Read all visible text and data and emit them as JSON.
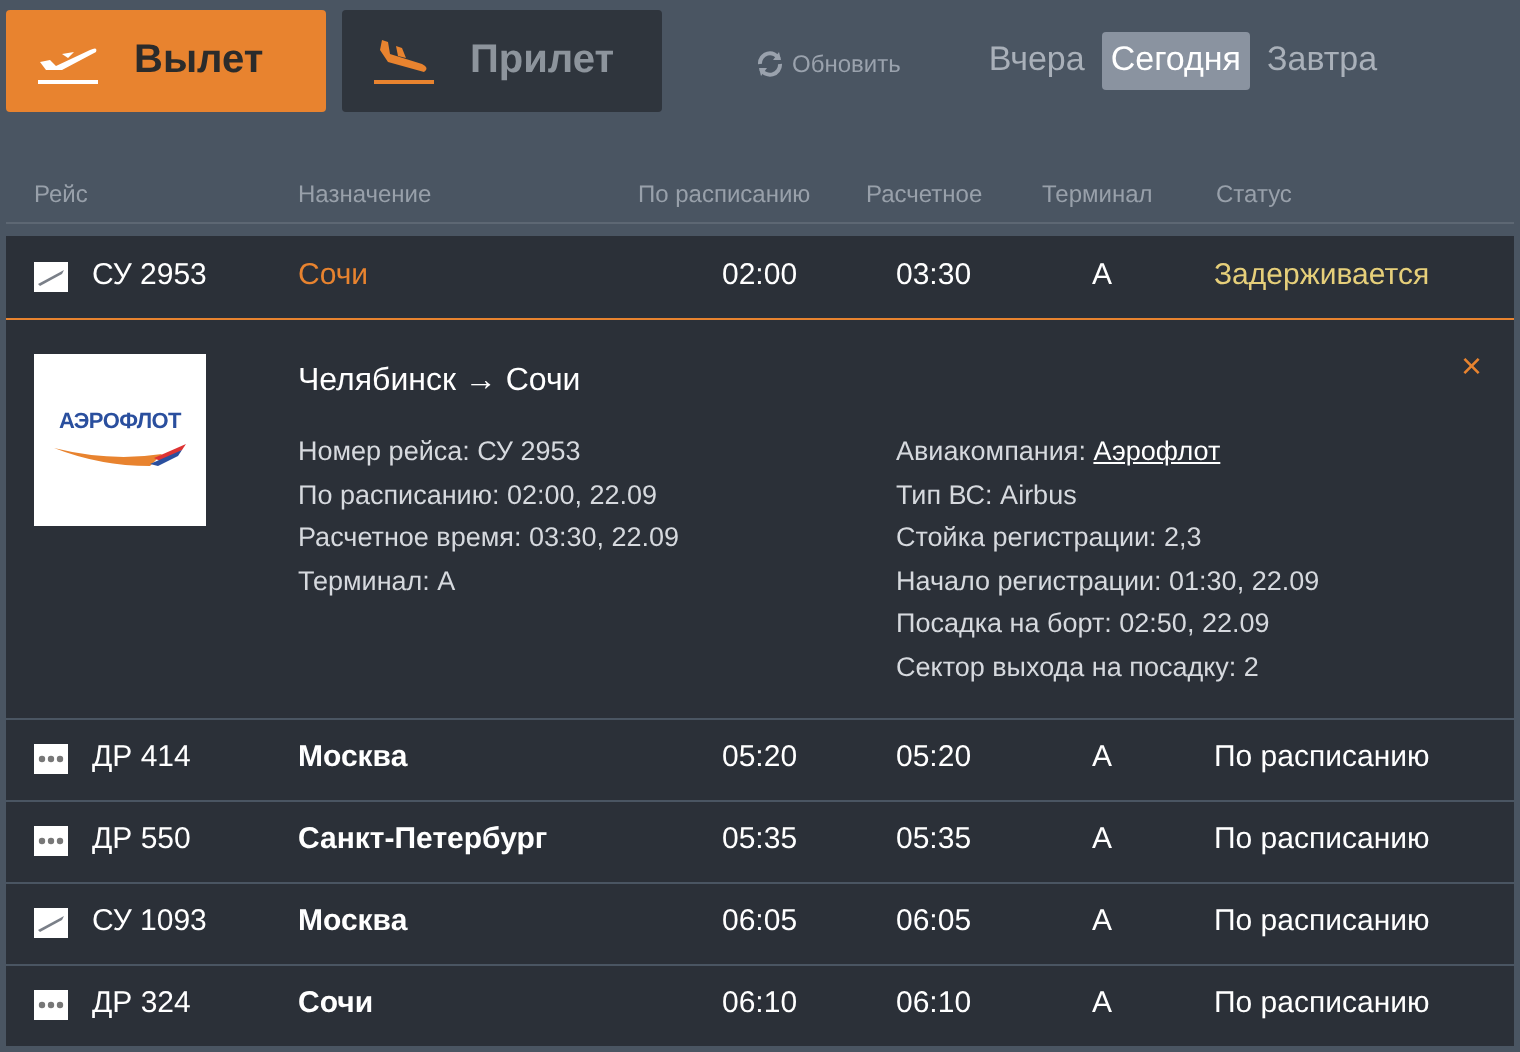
{
  "direction_tabs": [
    {
      "label": "Вылет",
      "kind": "departure",
      "selected": true
    },
    {
      "label": "Прилет",
      "kind": "arrival",
      "selected": false
    }
  ],
  "refresh": {
    "label": "Обновить"
  },
  "day_tabs": [
    {
      "label": "Вчера",
      "selected": false
    },
    {
      "label": "Сегодня",
      "selected": true
    },
    {
      "label": "Завтра",
      "selected": false
    }
  ],
  "table": {
    "columns": [
      "Рейс",
      "Назначение",
      "По расписанию",
      "Расчетное",
      "Терминал",
      "Статус"
    ],
    "rows": [
      {
        "kind": "plane",
        "flight": "СУ 2953",
        "destination": "Сочи",
        "scheduled": "02:00",
        "estimated": "03:30",
        "terminal": "A",
        "status": "Задерживается",
        "delayed": true,
        "expanded": true,
        "details": {
          "logo_text": "АЭРОФЛОТ",
          "route": "Челябинск → Сочи",
          "left": [
            "Номер рейса: СУ 2953",
            "По расписанию: 02:00, 22.09",
            "Расчетное время: 03:30, 22.09",
            "Терминал: A"
          ],
          "airline_label": "Авиакомпания: ",
          "airline_link": "Аэрофлот",
          "right": [
            "Тип ВС: Airbus",
            "Стойка регистрации: 2,3",
            "Начало регистрации: 01:30, 22.09",
            "Посадка на борт: 02:50, 22.09",
            "Сектор выхода на посадку: 2"
          ],
          "close": "×"
        }
      },
      {
        "kind": "dots",
        "flight": "ДР 414",
        "destination": "Москва",
        "scheduled": "05:20",
        "estimated": "05:20",
        "terminal": "A",
        "status": "По расписанию",
        "delayed": false,
        "expanded": false
      },
      {
        "kind": "dots",
        "flight": "ДР 550",
        "destination": "Санкт-Петербург",
        "scheduled": "05:35",
        "estimated": "05:35",
        "terminal": "A",
        "status": "По расписанию",
        "delayed": false,
        "expanded": false
      },
      {
        "kind": "plane",
        "flight": "СУ 1093",
        "destination": "Москва",
        "scheduled": "06:05",
        "estimated": "06:05",
        "terminal": "A",
        "status": "По расписанию",
        "delayed": false,
        "expanded": false
      },
      {
        "kind": "dots",
        "flight": "ДР 324",
        "destination": "Сочи",
        "scheduled": "06:10",
        "estimated": "06:10",
        "terminal": "A",
        "status": "По расписанию",
        "delayed": false,
        "expanded": false
      }
    ]
  }
}
